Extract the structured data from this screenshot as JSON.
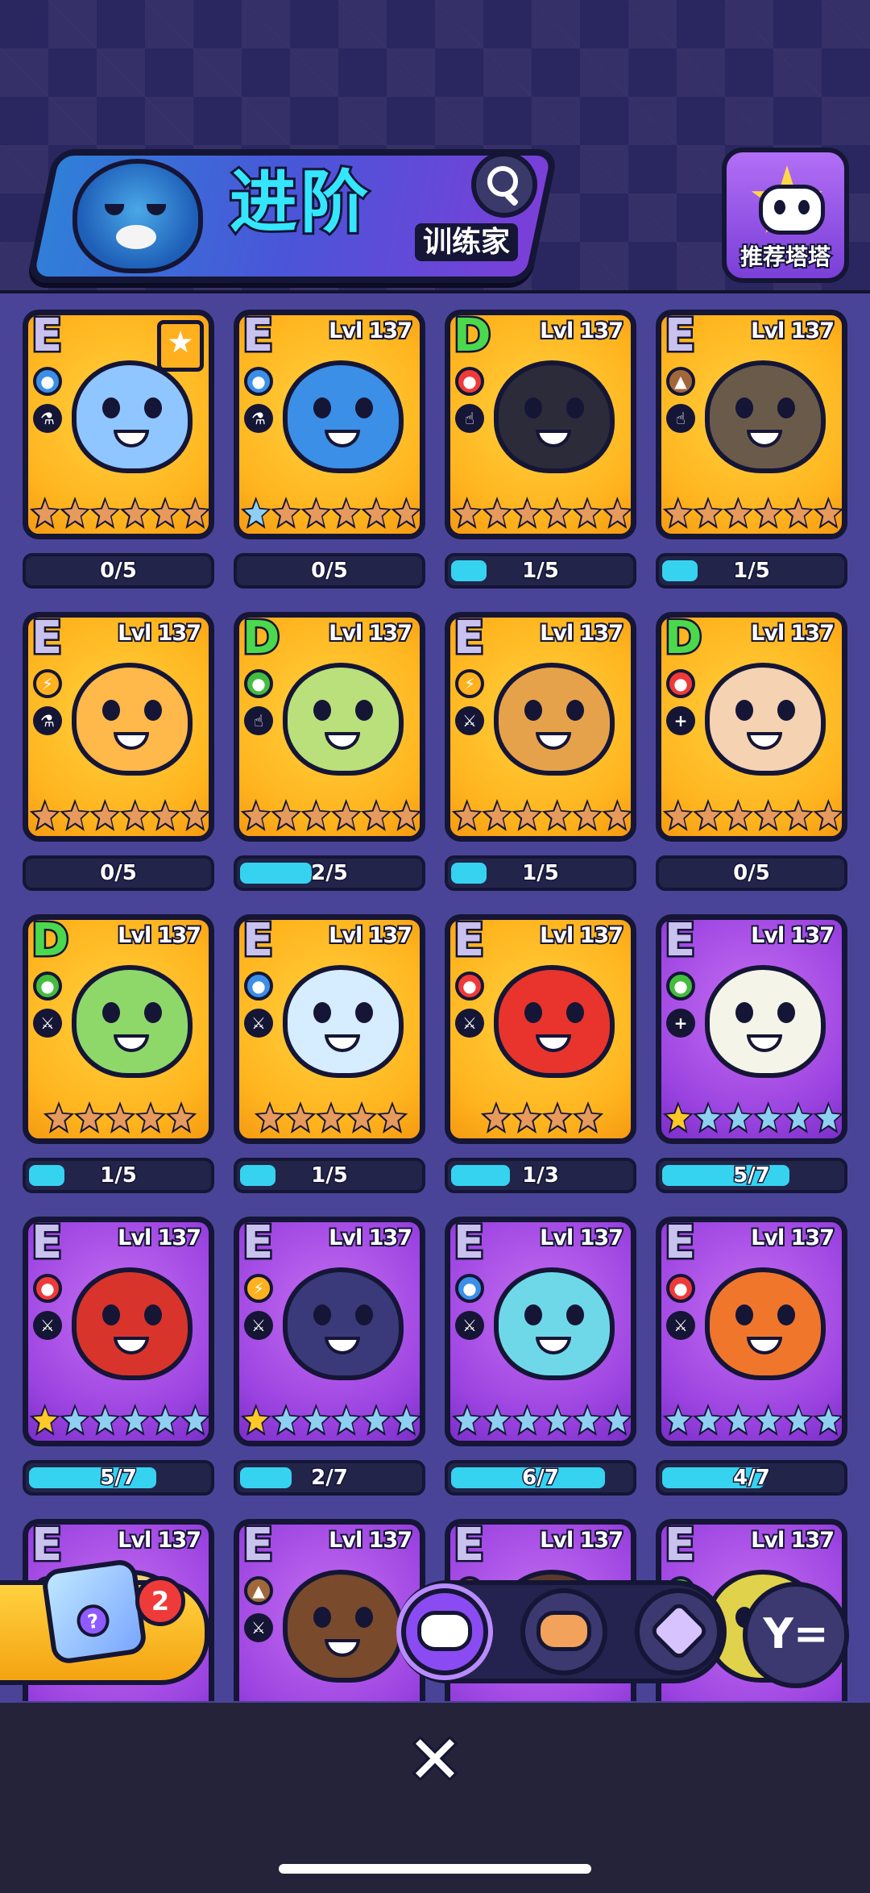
{
  "header": {
    "title": "进阶",
    "subtitle": "训练家",
    "recommend_label": "推荐塔塔",
    "search_icon": "search-icon"
  },
  "cards": [
    {
      "grade": "E",
      "level": "",
      "element": "water",
      "role": "potion",
      "bg": "gold",
      "stars": [
        "bronze",
        "bronze",
        "bronze",
        "bronze",
        "bronze",
        "bronze"
      ],
      "progress": "0/5",
      "fill": 0,
      "favorite": true,
      "color": "#8fc6ff"
    },
    {
      "grade": "E",
      "level": "Lvl 137",
      "element": "water",
      "role": "potion",
      "bg": "gold",
      "stars": [
        "silver",
        "bronze",
        "bronze",
        "bronze",
        "bronze",
        "bronze"
      ],
      "progress": "0/5",
      "fill": 0,
      "favorite": false,
      "color": "#3b8fe6"
    },
    {
      "grade": "D",
      "level": "Lvl 137",
      "element": "fire",
      "role": "pointer",
      "bg": "gold",
      "stars": [
        "bronze",
        "bronze",
        "bronze",
        "bronze",
        "bronze",
        "bronze"
      ],
      "progress": "1/5",
      "fill": 0.2,
      "favorite": false,
      "color": "#2b2b3a"
    },
    {
      "grade": "E",
      "level": "Lvl 137",
      "element": "earth",
      "role": "pointer",
      "bg": "gold",
      "stars": [
        "bronze",
        "bronze",
        "bronze",
        "bronze",
        "bronze",
        "bronze"
      ],
      "progress": "1/5",
      "fill": 0.2,
      "favorite": false,
      "color": "#6a5a4a"
    },
    {
      "grade": "E",
      "level": "Lvl 137",
      "element": "electric",
      "role": "potion",
      "bg": "gold",
      "stars": [
        "bronze",
        "bronze",
        "bronze",
        "bronze",
        "bronze",
        "bronze"
      ],
      "progress": "0/5",
      "fill": 0,
      "favorite": false,
      "color": "#ffb84a"
    },
    {
      "grade": "D",
      "level": "Lvl 137",
      "element": "plant",
      "role": "pointer",
      "bg": "gold",
      "stars": [
        "bronze",
        "bronze",
        "bronze",
        "bronze",
        "bronze",
        "bronze"
      ],
      "progress": "2/5",
      "fill": 0.4,
      "favorite": false,
      "color": "#b9e07a"
    },
    {
      "grade": "E",
      "level": "Lvl 137",
      "element": "electric",
      "role": "sword",
      "bg": "gold",
      "stars": [
        "bronze",
        "bronze",
        "bronze",
        "bronze",
        "bronze",
        "bronze"
      ],
      "progress": "1/5",
      "fill": 0.2,
      "favorite": false,
      "color": "#e6a24a"
    },
    {
      "grade": "D",
      "level": "Lvl 137",
      "element": "fire",
      "role": "plus",
      "bg": "gold",
      "stars": [
        "bronze",
        "bronze",
        "bronze",
        "bronze",
        "bronze",
        "bronze"
      ],
      "progress": "0/5",
      "fill": 0,
      "favorite": false,
      "color": "#f4d2b2"
    },
    {
      "grade": "D",
      "level": "Lvl 137",
      "element": "plant",
      "role": "sword",
      "bg": "gold",
      "stars": [
        "bronze",
        "bronze",
        "bronze",
        "bronze",
        "bronze"
      ],
      "progress": "1/5",
      "fill": 0.2,
      "favorite": false,
      "color": "#8ed86a"
    },
    {
      "grade": "E",
      "level": "Lvl 137",
      "element": "water",
      "role": "sword",
      "bg": "gold",
      "stars": [
        "bronze",
        "bronze",
        "bronze",
        "bronze",
        "bronze"
      ],
      "progress": "1/5",
      "fill": 0.2,
      "favorite": false,
      "color": "#d6ecff"
    },
    {
      "grade": "E",
      "level": "Lvl 137",
      "element": "fire",
      "role": "sword",
      "bg": "gold",
      "stars": [
        "bronze",
        "bronze",
        "bronze",
        "bronze"
      ],
      "progress": "1/3",
      "fill": 0.33,
      "favorite": false,
      "color": "#e8342c"
    },
    {
      "grade": "E",
      "level": "Lvl 137",
      "element": "plant",
      "role": "plus",
      "bg": "purple",
      "stars": [
        "gold",
        "silver",
        "silver",
        "silver",
        "silver",
        "silver"
      ],
      "progress": "5/7",
      "fill": 0.71,
      "favorite": false,
      "color": "#f4f4e8"
    },
    {
      "grade": "E",
      "level": "Lvl 137",
      "element": "fire",
      "role": "sword",
      "bg": "purple",
      "stars": [
        "gold",
        "silver",
        "silver",
        "silver",
        "silver",
        "silver"
      ],
      "progress": "5/7",
      "fill": 0.71,
      "favorite": false,
      "color": "#d8342c"
    },
    {
      "grade": "E",
      "level": "Lvl 137",
      "element": "electric",
      "role": "sword",
      "bg": "purple",
      "stars": [
        "gold",
        "silver",
        "silver",
        "silver",
        "silver",
        "silver"
      ],
      "progress": "2/7",
      "fill": 0.29,
      "favorite": false,
      "color": "#3a3a7a"
    },
    {
      "grade": "E",
      "level": "Lvl 137",
      "element": "water",
      "role": "sword",
      "bg": "purple",
      "stars": [
        "silver",
        "silver",
        "silver",
        "silver",
        "silver",
        "silver"
      ],
      "progress": "6/7",
      "fill": 0.86,
      "favorite": false,
      "color": "#6ed8e8"
    },
    {
      "grade": "E",
      "level": "Lvl 137",
      "element": "fire",
      "role": "sword",
      "bg": "purple",
      "stars": [
        "silver",
        "silver",
        "silver",
        "silver",
        "silver",
        "silver"
      ],
      "progress": "4/7",
      "fill": 0.57,
      "favorite": false,
      "color": "#f0762c"
    },
    {
      "grade": "E",
      "level": "Lvl 137",
      "element": "electric",
      "role": "sword",
      "bg": "purple",
      "stars": [],
      "progress": "",
      "fill": 0,
      "favorite": false,
      "color": "#f0d27a"
    },
    {
      "grade": "E",
      "level": "Lvl 137",
      "element": "earth",
      "role": "sword",
      "bg": "purple",
      "stars": [],
      "progress": "",
      "fill": 0,
      "favorite": false,
      "color": "#7a4a2c"
    },
    {
      "grade": "E",
      "level": "Lvl 137",
      "element": "fire",
      "role": "sword",
      "bg": "purple",
      "stars": [],
      "progress": "",
      "fill": 0,
      "favorite": false,
      "color": "#5a3a2a"
    },
    {
      "grade": "E",
      "level": "Lvl 137",
      "element": "plant",
      "role": "sword",
      "bg": "purple",
      "stars": [],
      "progress": "",
      "fill": 0,
      "favorite": false,
      "color": "#e0d24a"
    }
  ],
  "bottom_controls": {
    "gift_badge": "2",
    "filters": [
      "tower-filter-icon",
      "bear-filter-icon",
      "gem-filter-icon"
    ],
    "active_filter": 0,
    "sort_icon": "Y=",
    "close_label": "✕"
  }
}
